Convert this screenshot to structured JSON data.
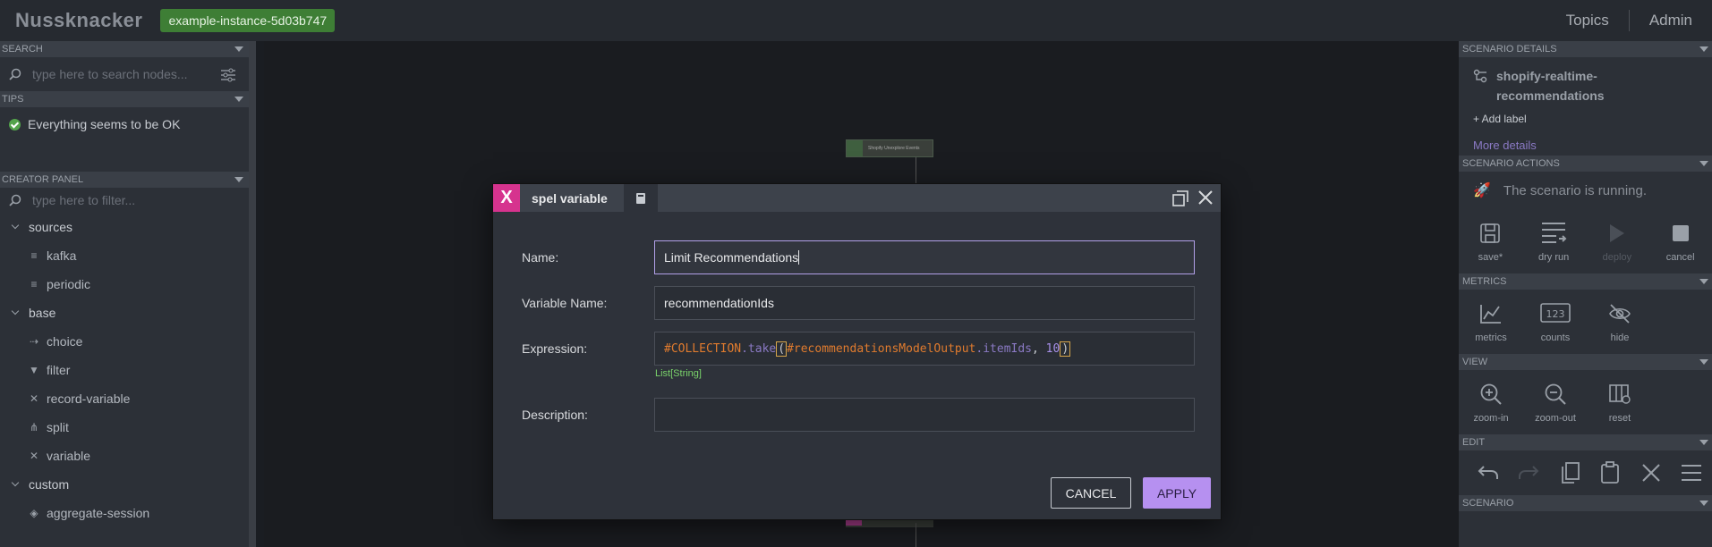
{
  "topbar": {
    "logo": "Nussknacker",
    "environment_badge": "example-instance-5d03b747",
    "nav": [
      "Topics",
      "Admin"
    ]
  },
  "left_panel": {
    "search": {
      "header": "SEARCH",
      "placeholder": "type here to search nodes..."
    },
    "tips": {
      "header": "TIPS",
      "message": "Everything seems to be OK"
    },
    "creator": {
      "header": "CREATOR PANEL",
      "placeholder": "type here to filter...",
      "groups": [
        {
          "name": "sources",
          "items": [
            {
              "label": "kafka",
              "icon": "database-icon"
            },
            {
              "label": "periodic",
              "icon": "database-icon"
            }
          ]
        },
        {
          "name": "base",
          "items": [
            {
              "label": "choice",
              "icon": "choice-icon"
            },
            {
              "label": "filter",
              "icon": "filter-icon"
            },
            {
              "label": "record-variable",
              "icon": "variable-icon"
            },
            {
              "label": "split",
              "icon": "split-icon"
            },
            {
              "label": "variable",
              "icon": "variable-icon"
            }
          ]
        },
        {
          "name": "custom",
          "items": [
            {
              "label": "aggregate-session",
              "icon": "aggregate-icon"
            }
          ]
        }
      ]
    }
  },
  "canvas": {
    "node_label": "Shopify Unexplore Events"
  },
  "right_panel": {
    "details": {
      "header": "SCENARIO DETAILS",
      "name": "shopify-realtime-recommendations",
      "add_label": "+ Add label",
      "more_details": "More details"
    },
    "actions": {
      "header": "SCENARIO ACTIONS",
      "status": "The scenario is running.",
      "buttons": [
        "save*",
        "dry run",
        "deploy",
        "cancel"
      ]
    },
    "metrics": {
      "header": "METRICS",
      "buttons": [
        "metrics",
        "counts",
        "hide"
      ]
    },
    "view": {
      "header": "VIEW",
      "buttons": [
        "zoom-in",
        "zoom-out",
        "reset"
      ]
    },
    "edit": {
      "header": "EDIT"
    },
    "scenario": {
      "header": "SCENARIO"
    }
  },
  "dialog": {
    "title": "spel variable",
    "fields": {
      "name_label": "Name:",
      "name_value": "Limit Recommendations",
      "varname_label": "Variable Name:",
      "varname_value": "recommendationIds",
      "expression_label": "Expression:",
      "expression_tokens": {
        "collection": "#COLLECTION",
        "take": ".take",
        "paren_open": "(",
        "var": "#recommendationsModelOutput",
        "prop": ".itemIds",
        "comma": ", ",
        "num": "10",
        "paren_close": ")"
      },
      "expression_type": "List[String]",
      "description_label": "Description:",
      "description_value": ""
    },
    "buttons": {
      "cancel": "CANCEL",
      "apply": "APPLY"
    }
  }
}
